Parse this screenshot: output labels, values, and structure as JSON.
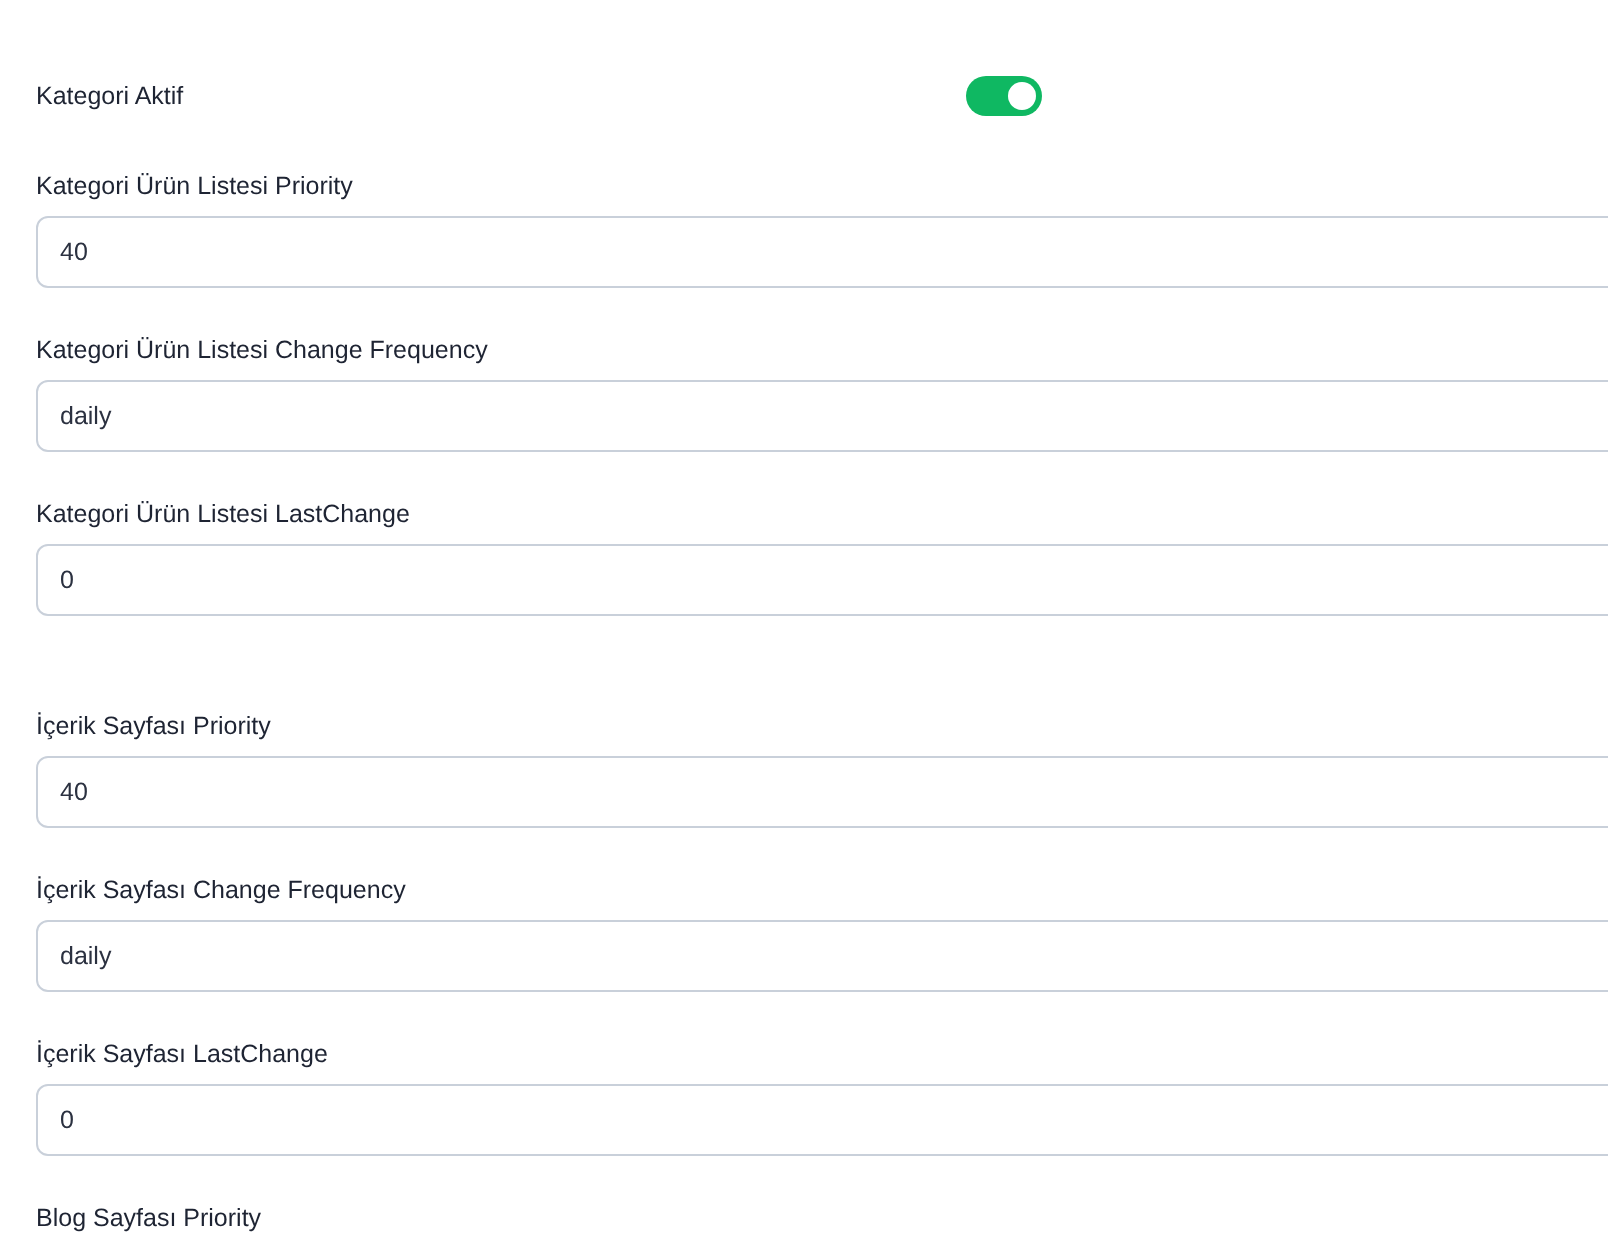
{
  "sections": [
    {
      "fields": [
        {
          "kind": "toggle",
          "label": "Kategori Aktif",
          "on": true
        },
        {
          "kind": "text",
          "label": "Kategori Ürün Listesi Priority",
          "value": "40"
        },
        {
          "kind": "text",
          "label": "Kategori Ürün Listesi Change Frequency",
          "value": "daily"
        },
        {
          "kind": "text",
          "label": "Kategori Ürün Listesi LastChange",
          "value": "0"
        }
      ]
    },
    {
      "fields": [
        {
          "kind": "text",
          "label": "İçerik Sayfası Priority",
          "value": "40"
        },
        {
          "kind": "text",
          "label": "İçerik Sayfası Change Frequency",
          "value": "daily"
        },
        {
          "kind": "text",
          "label": "İçerik Sayfası LastChange",
          "value": "0"
        },
        {
          "kind": "label",
          "label": "Blog Sayfası Priority"
        }
      ]
    }
  ]
}
